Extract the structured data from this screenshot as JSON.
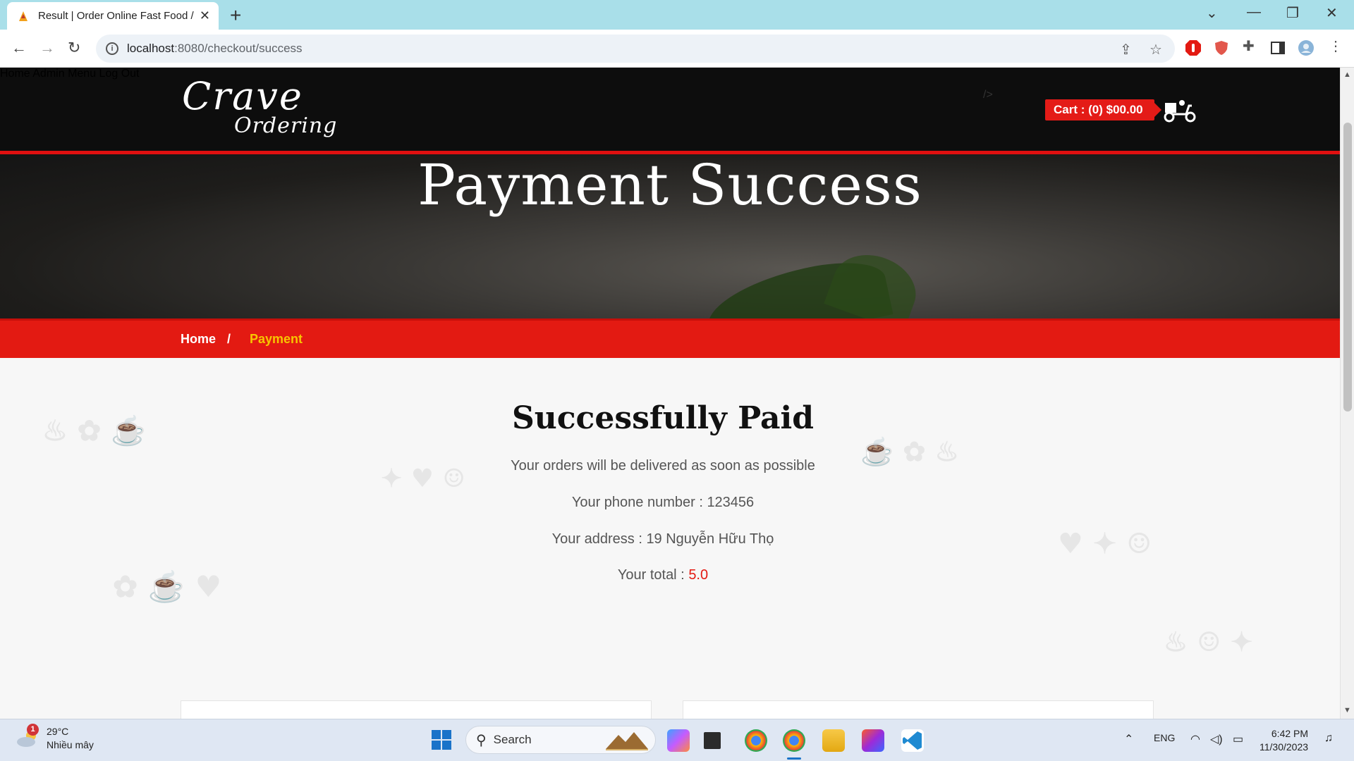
{
  "browser": {
    "tab_title": "Result | Order Online Fast Food /",
    "url_host": "localhost",
    "url_path": ":8080/checkout/success"
  },
  "site": {
    "logo_line1": "Crave",
    "logo_line2": "Ordering",
    "nav": [
      "Home",
      "Admin",
      "Menu",
      "Log Out"
    ],
    "faint_tag": "/>",
    "cart_label": "Cart : (0) $00.00"
  },
  "hero": {
    "title": "Payment Success"
  },
  "breadcrumb": {
    "home": "Home",
    "separator": "/",
    "current": "Payment",
    "current_color": "#f7c500"
  },
  "result": {
    "heading": "Successfully Paid",
    "line1": "Your orders will be delivered as soon as possible",
    "phone_label": "Your phone number : ",
    "phone_value": "123456",
    "address_label": "Your address : ",
    "address_value": "19 Nguyễn Hữu Thọ",
    "total_label": "Your total : ",
    "total_value": "5.0",
    "accent_color": "#e31a12"
  },
  "cards": [
    {
      "icon": "shopping-bag-icon"
    },
    {
      "icon": "credit-card-icon"
    }
  ],
  "taskbar": {
    "weather_temp": "29°C",
    "weather_desc": "Nhiều mây",
    "weather_badge": "1",
    "search_label": "Search",
    "language": "ENG",
    "time": "6:42 PM",
    "date": "11/30/2023"
  }
}
